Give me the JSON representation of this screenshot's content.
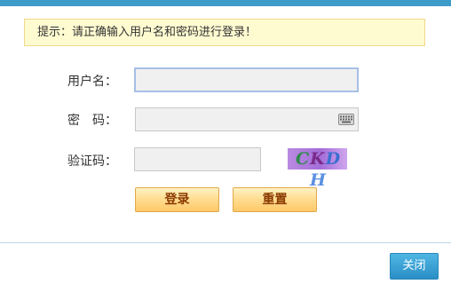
{
  "notice": {
    "text": "提示：请正确输入用户名和密码进行登录！"
  },
  "form": {
    "username_label": "用户名：",
    "username_value": "",
    "password_label": "密　码：",
    "password_value": "",
    "captcha_label": "验证码：",
    "captcha_value": ""
  },
  "captcha": {
    "chars": [
      "C",
      "K",
      "D",
      "H"
    ],
    "char_colors": [
      "#2f8a4a",
      "#7a2a8a",
      "#3a6fd0",
      "#5a8fe0"
    ]
  },
  "buttons": {
    "login_label": "登录",
    "reset_label": "重置",
    "close_label": "关闭"
  },
  "colors": {
    "accent": "#3d9bc9",
    "notice_bg": "#fffbd1",
    "button_gold": "#ffd98a",
    "close_blue": "#2a8fc6"
  },
  "icons": {
    "password_keyboard": "keyboard-icon"
  }
}
